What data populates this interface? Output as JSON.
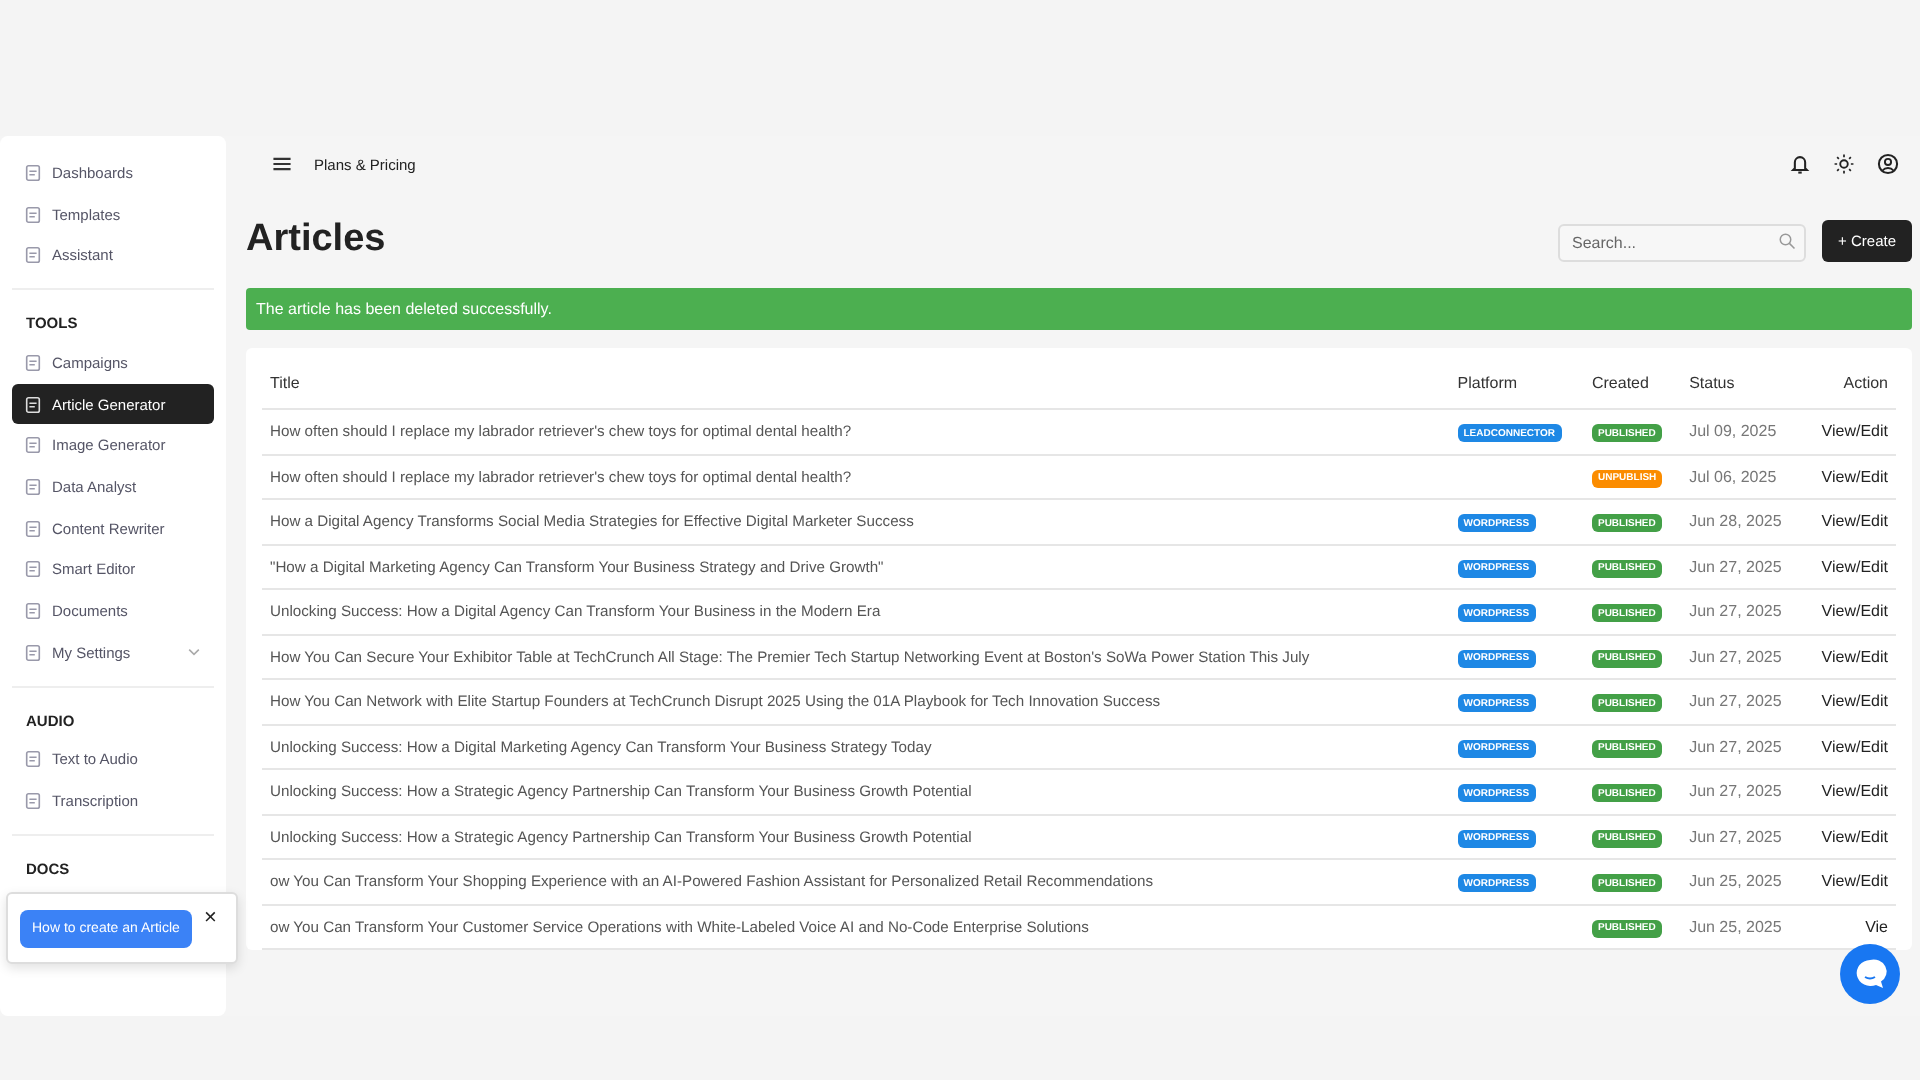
{
  "sidebar": {
    "sections": [
      {
        "items": [
          {
            "label": "Dashboards",
            "selected": false
          },
          {
            "label": "Templates",
            "selected": false
          },
          {
            "label": "Assistant",
            "selected": false
          }
        ]
      },
      {
        "heading": "TOOLS",
        "items": [
          {
            "label": "Campaigns",
            "selected": false
          },
          {
            "label": "Article Generator",
            "selected": true
          },
          {
            "label": "Image Generator",
            "selected": false
          },
          {
            "label": "Data Analyst",
            "selected": false
          },
          {
            "label": "Content Rewriter",
            "selected": false
          },
          {
            "label": "Smart Editor",
            "selected": false
          },
          {
            "label": "Documents",
            "selected": false
          },
          {
            "label": "My Settings",
            "selected": false,
            "expanded": false
          }
        ]
      },
      {
        "heading": "AUDIO",
        "items": [
          {
            "label": "Text to Audio",
            "selected": false
          },
          {
            "label": "Transcription",
            "selected": false
          }
        ]
      },
      {
        "heading": "DOCS"
      }
    ]
  },
  "popup": {
    "button": "How to create an Article",
    "close": "×"
  },
  "topbar": {
    "link": "Plans & Pricing"
  },
  "page_title": "Articles",
  "search": {
    "placeholder": "Search..."
  },
  "create_button": "+ Create",
  "alert": {
    "kind": "success",
    "text": "The article has been deleted successfully."
  },
  "table": {
    "columns": [
      "Title",
      "Platform",
      "Created",
      "Status",
      "Action"
    ],
    "rows": [
      {
        "title": "How often should I replace my labrador retriever's chew toys for optimal dental health?",
        "platform": "LEADCONNECTOR",
        "badge": {
          "label": "PUBLISHED",
          "color": "#43a047"
        },
        "date": "Jul 09, 2025",
        "action": "View/Edit"
      },
      {
        "title": "How often should I replace my labrador retriever's chew toys for optimal dental health?",
        "platform": null,
        "badge": {
          "label": "UNPUBLISH",
          "color": "#fb8c00"
        },
        "date": "Jul 06, 2025",
        "action": "View/Edit"
      },
      {
        "title": "How a Digital Agency Transforms Social Media Strategies for Effective Digital Marketer Success",
        "platform": "WORDPRESS",
        "badge": {
          "label": "PUBLISHED",
          "color": "#43a047"
        },
        "date": "Jun 28, 2025",
        "action": "View/Edit"
      },
      {
        "title": "\"How a Digital Marketing Agency Can Transform Your Business Strategy and Drive Growth\"",
        "platform": "WORDPRESS",
        "badge": {
          "label": "PUBLISHED",
          "color": "#43a047"
        },
        "date": "Jun 27, 2025",
        "action": "View/Edit"
      },
      {
        "title": "Unlocking Success: How a Digital Agency Can Transform Your Business in the Modern Era",
        "platform": "WORDPRESS",
        "badge": {
          "label": "PUBLISHED",
          "color": "#43a047"
        },
        "date": "Jun 27, 2025",
        "action": "View/Edit"
      },
      {
        "title": "How You Can Secure Your Exhibitor Table at TechCrunch All Stage: The Premier Tech Startup Networking Event at Boston's SoWa Power Station This July",
        "platform": "WORDPRESS",
        "badge": {
          "label": "PUBLISHED",
          "color": "#43a047"
        },
        "date": "Jun 27, 2025",
        "action": "View/Edit"
      },
      {
        "title": "How You Can Network with Elite Startup Founders at TechCrunch Disrupt 2025 Using the 01A Playbook for Tech Innovation Success",
        "platform": "WORDPRESS",
        "badge": {
          "label": "PUBLISHED",
          "color": "#43a047"
        },
        "date": "Jun 27, 2025",
        "action": "View/Edit"
      },
      {
        "title": "Unlocking Success: How a Digital Marketing Agency Can Transform Your Business Strategy Today",
        "platform": "WORDPRESS",
        "badge": {
          "label": "PUBLISHED",
          "color": "#43a047"
        },
        "date": "Jun 27, 2025",
        "action": "View/Edit"
      },
      {
        "title": "Unlocking Success: How a Strategic Agency Partnership Can Transform Your Business Growth Potential",
        "platform": "WORDPRESS",
        "badge": {
          "label": "PUBLISHED",
          "color": "#43a047"
        },
        "date": "Jun 27, 2025",
        "action": "View/Edit"
      },
      {
        "title": "Unlocking Success: How a Strategic Agency Partnership Can Transform Your Business Growth Potential",
        "platform": "WORDPRESS",
        "badge": {
          "label": "PUBLISHED",
          "color": "#43a047"
        },
        "date": "Jun 27, 2025",
        "action": "View/Edit"
      },
      {
        "title": "ow You Can Transform Your Shopping Experience with an AI-Powered Fashion Assistant for Personalized Retail Recommendations",
        "platform": "WORDPRESS",
        "badge": {
          "label": "PUBLISHED",
          "color": "#43a047"
        },
        "date": "Jun 25, 2025",
        "action": "View/Edit"
      },
      {
        "title": "ow You Can Transform Your Customer Service Operations with White-Labeled Voice AI and No-Code Enterprise Solutions",
        "platform": null,
        "badge": {
          "label": "PUBLISHED",
          "color": "#43a047"
        },
        "date": "Jun 25, 2025",
        "action": "Vie"
      }
    ]
  }
}
